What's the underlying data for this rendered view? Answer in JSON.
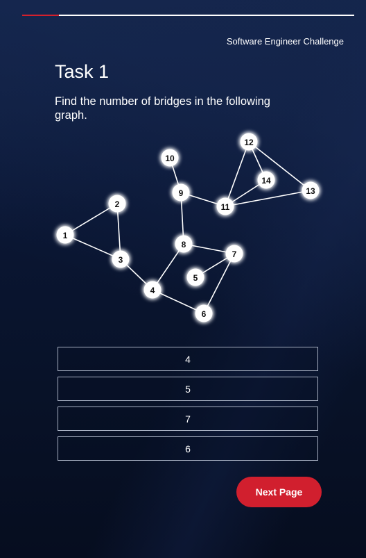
{
  "progress": {
    "fraction": 0.11
  },
  "header": {
    "title": "Software Engineer Challenge"
  },
  "task": {
    "title": "Task 1",
    "question": "Find the number of bridges in the following graph."
  },
  "graph": {
    "nodes": [
      "1",
      "2",
      "3",
      "4",
      "5",
      "6",
      "7",
      "8",
      "9",
      "10",
      "11",
      "12",
      "13",
      "14"
    ],
    "edges": [
      [
        "1",
        "2"
      ],
      [
        "1",
        "3"
      ],
      [
        "2",
        "3"
      ],
      [
        "3",
        "4"
      ],
      [
        "4",
        "8"
      ],
      [
        "4",
        "6"
      ],
      [
        "6",
        "7"
      ],
      [
        "5",
        "7"
      ],
      [
        "8",
        "7"
      ],
      [
        "8",
        "9"
      ],
      [
        "9",
        "10"
      ],
      [
        "9",
        "11"
      ],
      [
        "11",
        "12"
      ],
      [
        "11",
        "14"
      ],
      [
        "11",
        "13"
      ],
      [
        "12",
        "14"
      ],
      [
        "12",
        "13"
      ]
    ]
  },
  "answers": [
    "4",
    "5",
    "7",
    "6"
  ],
  "next_button": {
    "label": "Next Page"
  },
  "colors": {
    "accent": "#d11f2e",
    "background": "#0a1633",
    "text": "#ffffff"
  }
}
